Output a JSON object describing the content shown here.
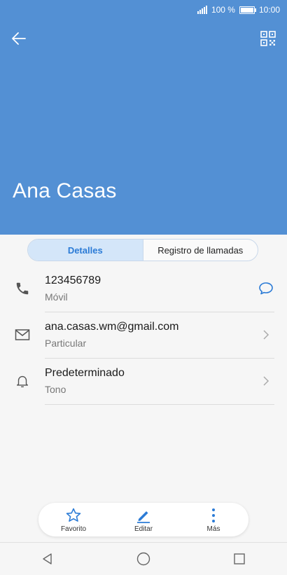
{
  "status_bar": {
    "battery_text": "100 %",
    "battery_level": 1.0,
    "time": "10:00"
  },
  "header": {
    "back_icon": "arrow-left-icon",
    "qr_icon": "qr-code-icon",
    "contact_name": "Ana Casas",
    "background_color": "#5390d4"
  },
  "tabs": [
    {
      "label": "Detalles",
      "active": true
    },
    {
      "label": "Registro de llamadas",
      "active": false
    }
  ],
  "details": [
    {
      "icon": "phone-icon",
      "primary": "123456789",
      "secondary": "Móvil",
      "action_icon": "message-bubble-icon"
    },
    {
      "icon": "mail-icon",
      "primary": "ana.casas.wm@gmail.com",
      "secondary": "Particular",
      "action_icon": "chevron-right-icon"
    },
    {
      "icon": "bell-icon",
      "primary": "Predeterminado",
      "secondary": "Tono",
      "action_icon": "chevron-right-icon"
    }
  ],
  "toolbar": {
    "favorite_label": "Favorito",
    "edit_label": "Editar",
    "more_label": "Más",
    "accent_color": "#2b7bd6"
  },
  "navbar": {
    "back_icon": "nav-back-icon",
    "home_icon": "nav-home-icon",
    "recents_icon": "nav-recents-icon"
  }
}
